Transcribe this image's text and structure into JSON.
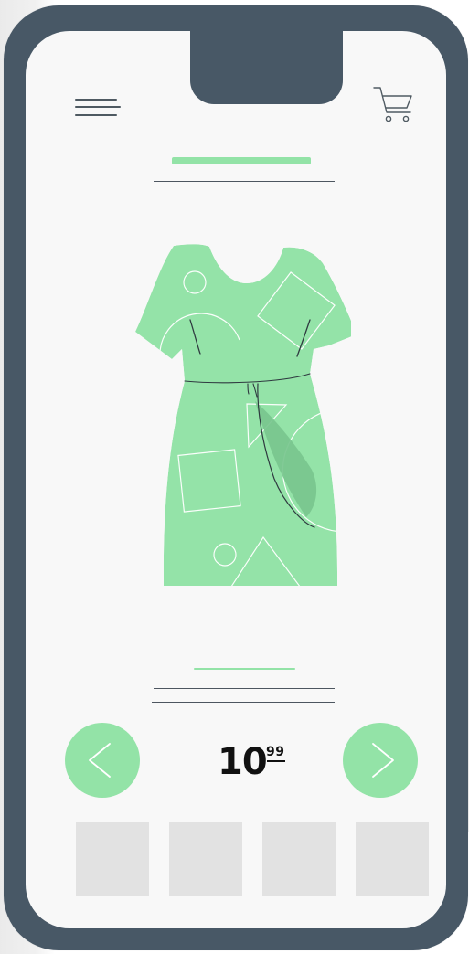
{
  "colors": {
    "frame": "#485866",
    "screen": "#f8f8f8",
    "accent_green": "#93e3a7",
    "dress_green": "#94e3a8",
    "thumbnail_gray": "#e2e2e2",
    "line_gray": "#4d5660",
    "text_dark": "#111111"
  },
  "header": {
    "menu_icon": "hamburger-menu-icon",
    "cart_icon": "shopping-cart-icon"
  },
  "product": {
    "image_icon": "green-dress-illustration"
  },
  "pricing": {
    "main": "10",
    "cents": "99"
  },
  "navigation": {
    "previous_icon": "chevron-left-icon",
    "next_icon": "chevron-right-icon"
  },
  "thumbnails": [
    {},
    {},
    {},
    {}
  ]
}
